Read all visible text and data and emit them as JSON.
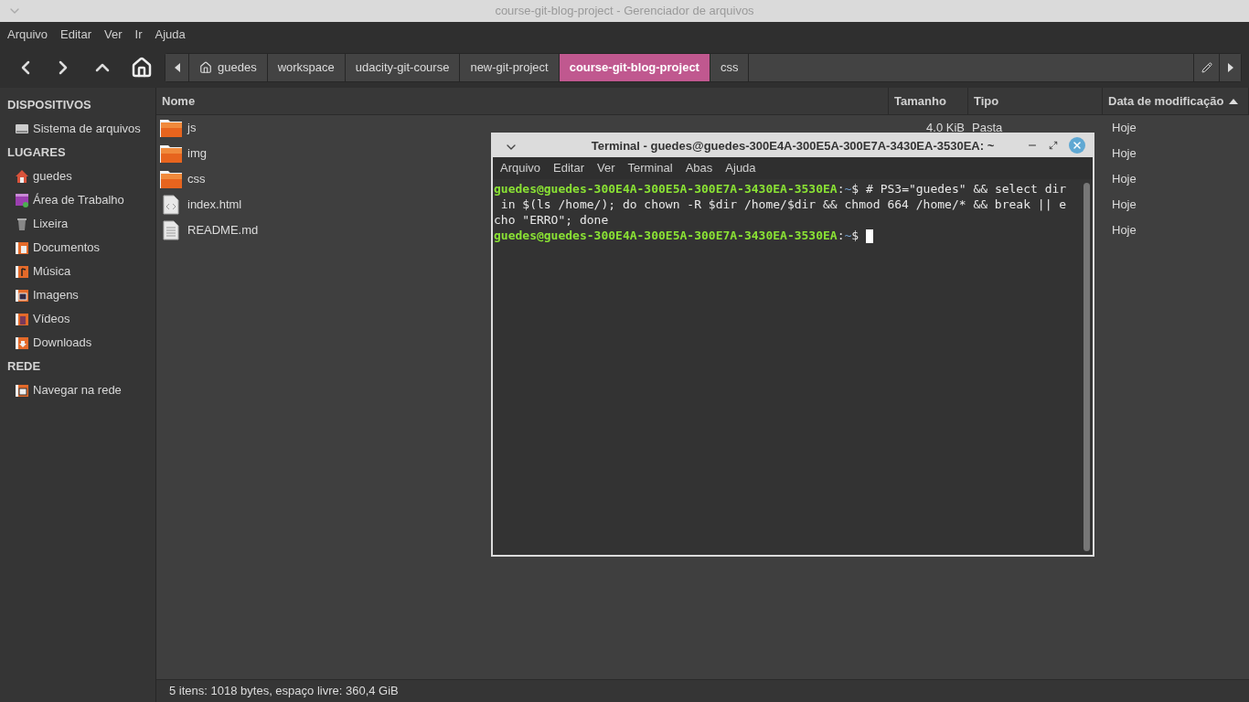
{
  "window": {
    "title": "course-git-blog-project - Gerenciador de arquivos"
  },
  "menu": [
    "Arquivo",
    "Editar",
    "Ver",
    "Ir",
    "Ajuda"
  ],
  "breadcrumb": [
    {
      "label": "guedes",
      "kind": "home",
      "selected": false
    },
    {
      "label": "workspace",
      "kind": "folder",
      "selected": false
    },
    {
      "label": "udacity-git-course",
      "kind": "folder",
      "selected": false
    },
    {
      "label": "new-git-project",
      "kind": "folder",
      "selected": false
    },
    {
      "label": "course-git-blog-project",
      "kind": "folder",
      "selected": true
    },
    {
      "label": "css",
      "kind": "folder",
      "selected": false
    }
  ],
  "sidebar": [
    {
      "heading": "DISPOSITIVOS",
      "items": [
        {
          "label": "Sistema de arquivos",
          "kind": "drive"
        }
      ]
    },
    {
      "heading": "LUGARES",
      "items": [
        {
          "label": "guedes",
          "kind": "home"
        },
        {
          "label": "Área de Trabalho",
          "kind": "desktop"
        },
        {
          "label": "Lixeira",
          "kind": "trash"
        },
        {
          "label": "Documentos",
          "kind": "documents"
        },
        {
          "label": "Música",
          "kind": "music"
        },
        {
          "label": "Imagens",
          "kind": "pictures"
        },
        {
          "label": "Vídeos",
          "kind": "videos"
        },
        {
          "label": "Downloads",
          "kind": "downloads"
        }
      ]
    },
    {
      "heading": "REDE",
      "items": [
        {
          "label": "Navegar na rede",
          "kind": "network"
        }
      ]
    }
  ],
  "table": {
    "columns": [
      {
        "label": "Nome"
      },
      {
        "label": "Tamanho"
      },
      {
        "label": "Tipo"
      },
      {
        "label": "Data de modificação",
        "sorted": true
      }
    ],
    "rows": [
      {
        "name": "js",
        "kind": "folder",
        "size": "4.0 KiB",
        "type": "Pasta",
        "date": "Hoje"
      },
      {
        "name": "img",
        "kind": "folder",
        "date": "Hoje"
      },
      {
        "name": "css",
        "kind": "folder",
        "date": "Hoje"
      },
      {
        "name": "index.html",
        "kind": "html",
        "date": "Hoje"
      },
      {
        "name": "README.md",
        "kind": "text",
        "date": "Hoje"
      }
    ]
  },
  "status_bar": "5 itens: 1018 bytes, espaço livre: 360,4 GiB",
  "terminal": {
    "title": "Terminal - guedes@guedes-300E4A-300E5A-300E7A-3430EA-3530EA: ~",
    "menu": [
      "Arquivo",
      "Editar",
      "Ver",
      "Terminal",
      "Abas",
      "Ajuda"
    ],
    "lines": [
      {
        "kind": "prompt",
        "user": "guedes@guedes-300E4A-300E5A-300E7A-3430EA-3530EA",
        "sep": ":",
        "path": "~",
        "text": "$ # PS3=\"guedes\" && select dir"
      },
      {
        "kind": "output",
        "text": " in $(ls /home/); do chown -R $dir /home/$dir && chmod 664 /home/* && break || e"
      },
      {
        "kind": "output",
        "text": "cho \"ERRO\"; done"
      },
      {
        "kind": "prompt",
        "user": "guedes@guedes-300E4A-300E5A-300E7A-3430EA-3530EA",
        "sep": ":",
        "path": "~",
        "text": "$ ",
        "cursor": true
      }
    ]
  }
}
